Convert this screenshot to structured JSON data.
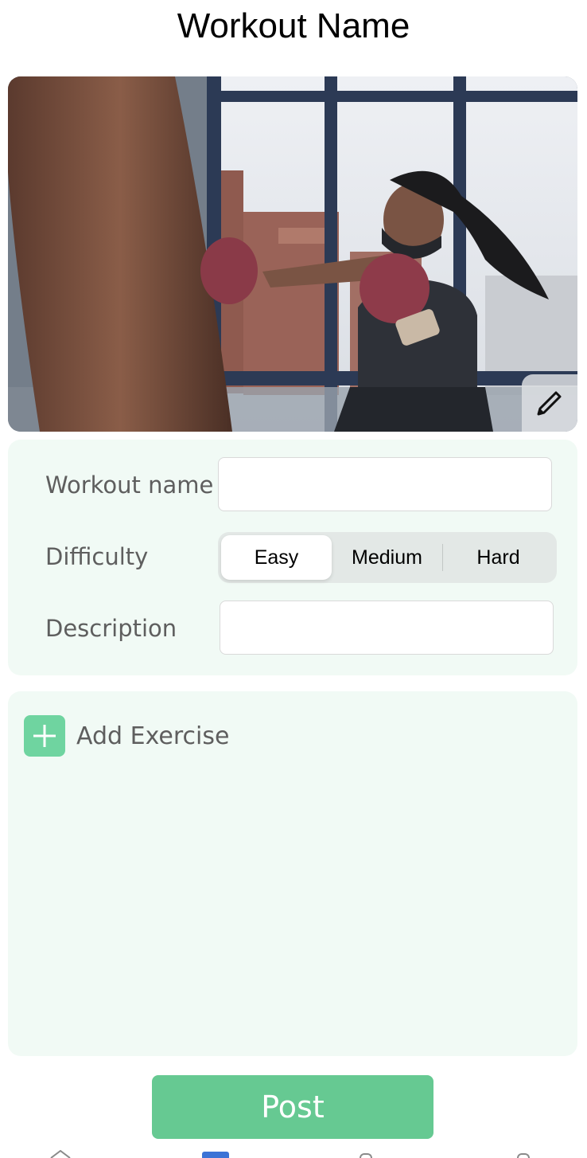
{
  "page": {
    "title": "Workout Name"
  },
  "hero": {
    "image_icon": "boxing-photo",
    "edit_icon": "pencil-icon"
  },
  "form": {
    "workout_name_label": "Workout name",
    "workout_name_value": "",
    "difficulty_label": "Difficulty",
    "difficulty_options": [
      "Easy",
      "Medium",
      "Hard"
    ],
    "difficulty_selected": "Easy",
    "description_label": "Description",
    "description_value": ""
  },
  "exercises": {
    "add_label": "Add Exercise",
    "add_icon": "plus-icon"
  },
  "actions": {
    "post_label": "Post"
  },
  "colors": {
    "accent_green": "#66c992",
    "plus_green": "#6fd4a0",
    "card_background": "#f1faf5",
    "label_gray": "#5e5e5e"
  }
}
